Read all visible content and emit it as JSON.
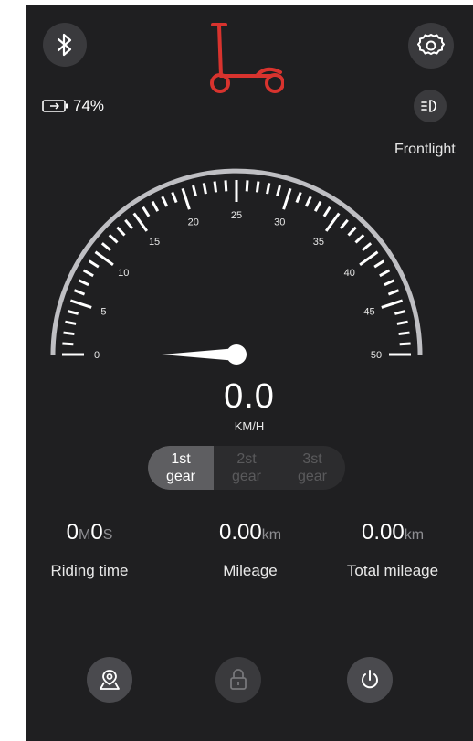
{
  "header": {
    "bluetooth_icon": "bluetooth-icon",
    "scooter_icon": "scooter-icon",
    "settings_icon": "gear-icon",
    "battery_percent": "74%",
    "frontlight_label": "Frontlight",
    "brand_color": "#d8332e"
  },
  "speedometer": {
    "ticks": [
      "0",
      "5",
      "10",
      "15",
      "20",
      "25",
      "30",
      "35",
      "40",
      "45",
      "50"
    ],
    "speed": "0.0",
    "unit": "KM/H",
    "speed_value": 0,
    "max_speed": 50
  },
  "gears": [
    {
      "top": "1st",
      "bottom": "gear",
      "active": true
    },
    {
      "top": "2st",
      "bottom": "gear",
      "active": false
    },
    {
      "top": "3st",
      "bottom": "gear",
      "active": false
    }
  ],
  "stats": {
    "riding_time": {
      "m": "0",
      "m_unit": "M",
      "s": "0",
      "s_unit": "S",
      "label": "Riding time"
    },
    "mileage": {
      "value": "0.00",
      "unit": "km",
      "label": "Mileage"
    },
    "total_mileage": {
      "value": "0.00",
      "unit": "km",
      "label": "Total mileage"
    }
  },
  "bottom_bar": {
    "location_icon": "location-pin-icon",
    "lock_icon": "lock-icon",
    "power_icon": "power-icon"
  }
}
